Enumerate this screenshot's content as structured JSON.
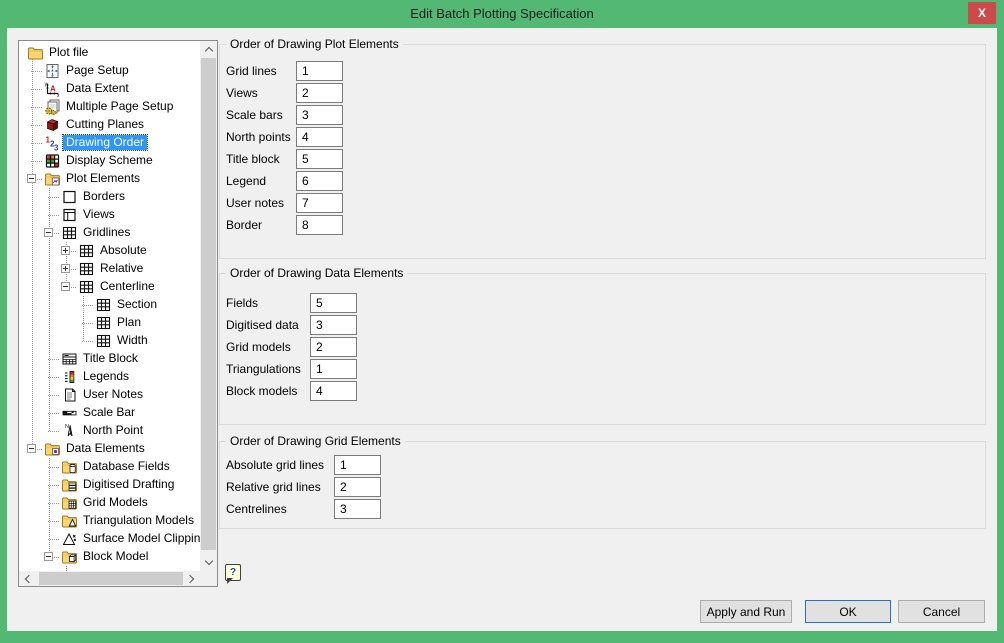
{
  "window": {
    "title": "Edit Batch Plotting Specification",
    "close_glyph": "X"
  },
  "colors": {
    "titlebar": "#53b874",
    "close": "#cb4b4b",
    "selection": "#2e96fa"
  },
  "tree": {
    "items": [
      {
        "label": "Plot file",
        "icon": "folder-icon",
        "level": 0,
        "expander": null,
        "selected": false
      },
      {
        "label": "Page Setup",
        "icon": "page-setup-icon",
        "level": 1,
        "expander": null,
        "selected": false
      },
      {
        "label": "Data Extent",
        "icon": "data-extent-icon",
        "level": 1,
        "expander": null,
        "selected": false
      },
      {
        "label": "Multiple Page Setup",
        "icon": "multiple-page-setup-icon",
        "level": 1,
        "expander": null,
        "selected": false
      },
      {
        "label": "Cutting Planes",
        "icon": "cutting-planes-icon",
        "level": 1,
        "expander": null,
        "selected": false
      },
      {
        "label": "Drawing Order",
        "icon": "drawing-order-icon",
        "level": 1,
        "expander": null,
        "selected": true
      },
      {
        "label": "Display Scheme",
        "icon": "display-scheme-icon",
        "level": 1,
        "expander": null,
        "selected": false
      },
      {
        "label": "Plot Elements",
        "icon": "plot-elements-folder-icon",
        "level": 1,
        "expander": "-",
        "selected": false
      },
      {
        "label": "Borders",
        "icon": "borders-icon",
        "level": 2,
        "expander": null,
        "selected": false
      },
      {
        "label": "Views",
        "icon": "views-icon",
        "level": 2,
        "expander": null,
        "selected": false
      },
      {
        "label": "Gridlines",
        "icon": "grid-icon",
        "level": 2,
        "expander": "-",
        "selected": false
      },
      {
        "label": "Absolute",
        "icon": "grid-icon",
        "level": 3,
        "expander": "+",
        "selected": false
      },
      {
        "label": "Relative",
        "icon": "grid-icon",
        "level": 3,
        "expander": "+",
        "selected": false
      },
      {
        "label": "Centerline",
        "icon": "grid-icon",
        "level": 3,
        "expander": "-",
        "selected": false
      },
      {
        "label": "Section",
        "icon": "grid-icon",
        "level": 4,
        "expander": null,
        "selected": false
      },
      {
        "label": "Plan",
        "icon": "grid-icon",
        "level": 4,
        "expander": null,
        "selected": false
      },
      {
        "label": "Width",
        "icon": "grid-icon",
        "level": 4,
        "expander": null,
        "selected": false
      },
      {
        "label": "Title Block",
        "icon": "title-block-icon",
        "level": 2,
        "expander": null,
        "selected": false
      },
      {
        "label": "Legends",
        "icon": "legends-icon",
        "level": 2,
        "expander": null,
        "selected": false
      },
      {
        "label": "User Notes",
        "icon": "user-notes-icon",
        "level": 2,
        "expander": null,
        "selected": false
      },
      {
        "label": "Scale Bar",
        "icon": "scale-bar-icon",
        "level": 2,
        "expander": null,
        "selected": false
      },
      {
        "label": "North Point",
        "icon": "north-point-icon",
        "level": 2,
        "expander": null,
        "selected": false
      },
      {
        "label": "Data Elements",
        "icon": "data-elements-folder-icon",
        "level": 1,
        "expander": "-",
        "selected": false
      },
      {
        "label": "Database Fields",
        "icon": "database-folder-icon",
        "level": 2,
        "expander": null,
        "selected": false
      },
      {
        "label": "Digitised Drafting",
        "icon": "drafting-folder-icon",
        "level": 2,
        "expander": null,
        "selected": false
      },
      {
        "label": "Grid Models",
        "icon": "grid-folder-icon",
        "level": 2,
        "expander": null,
        "selected": false
      },
      {
        "label": "Triangulation Models",
        "icon": "triangulation-folder-icon",
        "level": 2,
        "expander": null,
        "selected": false
      },
      {
        "label": "Surface Model Clippin",
        "icon": "surface-clipping-icon",
        "level": 2,
        "expander": null,
        "selected": false
      },
      {
        "label": "Block Model",
        "icon": "block-model-folder-icon",
        "level": 2,
        "expander": "-",
        "selected": false
      },
      {
        "label": "",
        "icon": "block-item-icon",
        "level": 3,
        "expander": null,
        "selected": false
      }
    ]
  },
  "groups": [
    {
      "title": "Order of Drawing Plot Elements",
      "fields": [
        {
          "label": "Grid lines",
          "value": "1"
        },
        {
          "label": "Views",
          "value": "2"
        },
        {
          "label": "Scale bars",
          "value": "3"
        },
        {
          "label": "North points",
          "value": "4"
        },
        {
          "label": "Title block",
          "value": "5"
        },
        {
          "label": "Legend",
          "value": "6"
        },
        {
          "label": "User notes",
          "value": "7"
        },
        {
          "label": "Border",
          "value": "8"
        }
      ]
    },
    {
      "title": "Order of Drawing Data Elements",
      "fields": [
        {
          "label": "Fields",
          "value": "5"
        },
        {
          "label": "Digitised data",
          "value": "3"
        },
        {
          "label": "Grid models",
          "value": "2"
        },
        {
          "label": "Triangulations",
          "value": "1"
        },
        {
          "label": "Block models",
          "value": "4"
        }
      ]
    },
    {
      "title": "Order of Drawing Grid Elements",
      "fields": [
        {
          "label": "Absolute grid lines",
          "value": "1"
        },
        {
          "label": "Relative grid lines",
          "value": "2"
        },
        {
          "label": "Centrelines",
          "value": "3"
        }
      ]
    }
  ],
  "help": {
    "glyph": "?"
  },
  "buttons": {
    "apply_and_run": "Apply and Run",
    "ok": "OK",
    "cancel": "Cancel"
  }
}
